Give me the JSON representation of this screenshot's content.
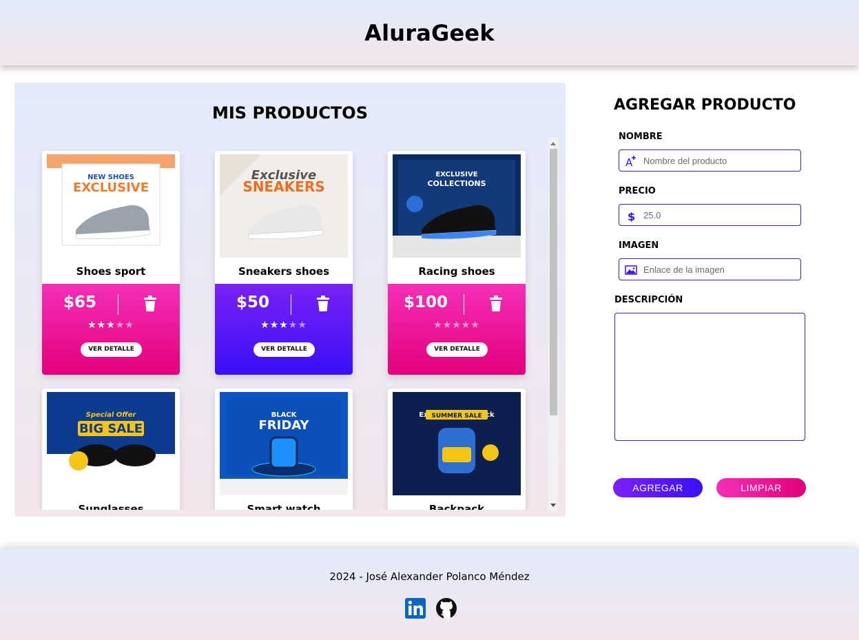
{
  "header": {
    "title": "AluraGeek"
  },
  "products": {
    "title": "MIS PRODUCTOS",
    "detail_label": "VER DETALLE",
    "items": [
      {
        "name": "Shoes sport",
        "price": "$65",
        "rating": 3,
        "color": "pink",
        "image": "shoes-exclusive-image",
        "art": {
          "top": "NEW SHOES",
          "main": "EXCLUSIVE"
        }
      },
      {
        "name": "Sneakers shoes",
        "price": "$50",
        "rating": 3,
        "color": "purple",
        "image": "sneakers-exclusive-image",
        "art": {
          "top": "Exclusive",
          "main": "SNEAKERS"
        }
      },
      {
        "name": "Racing shoes",
        "price": "$100",
        "rating": 0,
        "color": "pink",
        "image": "racing-shoes-image",
        "art": {
          "top": "EXCLUSIVE",
          "main": "COLLECTIONS"
        }
      },
      {
        "name": "Sunglasses",
        "price": "",
        "rating": 0,
        "color": "pink",
        "image": "sunglasses-image",
        "art": {
          "top": "Special Offer",
          "main": "BIG SALE"
        }
      },
      {
        "name": "Smart watch",
        "price": "",
        "rating": 0,
        "color": "pink",
        "image": "smart-watch-image",
        "art": {
          "top": "BLACK",
          "main": "FRIDAY"
        }
      },
      {
        "name": "Backpack",
        "price": "",
        "rating": 0,
        "color": "pink",
        "image": "backpack-image",
        "art": {
          "top": "Exclusive Backpack",
          "main": "SUMMER SALE"
        }
      }
    ]
  },
  "form": {
    "title": "AGREGAR PRODUCTO",
    "name": {
      "label": "NOMBRE",
      "placeholder": "Nombre del producto",
      "icon": "text-add-icon"
    },
    "price": {
      "label": "PRECIO",
      "placeholder": "25.0",
      "icon": "dollar-icon"
    },
    "image": {
      "label": "IMAGEN",
      "placeholder": "Enlace de la imagen",
      "icon": "image-icon"
    },
    "description": {
      "label": "DESCRIPCIÓN",
      "value": ""
    },
    "add_label": "AGREGAR",
    "clear_label": "LIMPIAR"
  },
  "footer": {
    "text": "2024 - José Alexander Polanco Méndez",
    "links": [
      {
        "icon": "linkedin-icon"
      },
      {
        "icon": "github-icon"
      }
    ]
  },
  "colors": {
    "pink": "#e3007b",
    "purple": "#3a0ff7",
    "border": "#4a1ea0"
  }
}
